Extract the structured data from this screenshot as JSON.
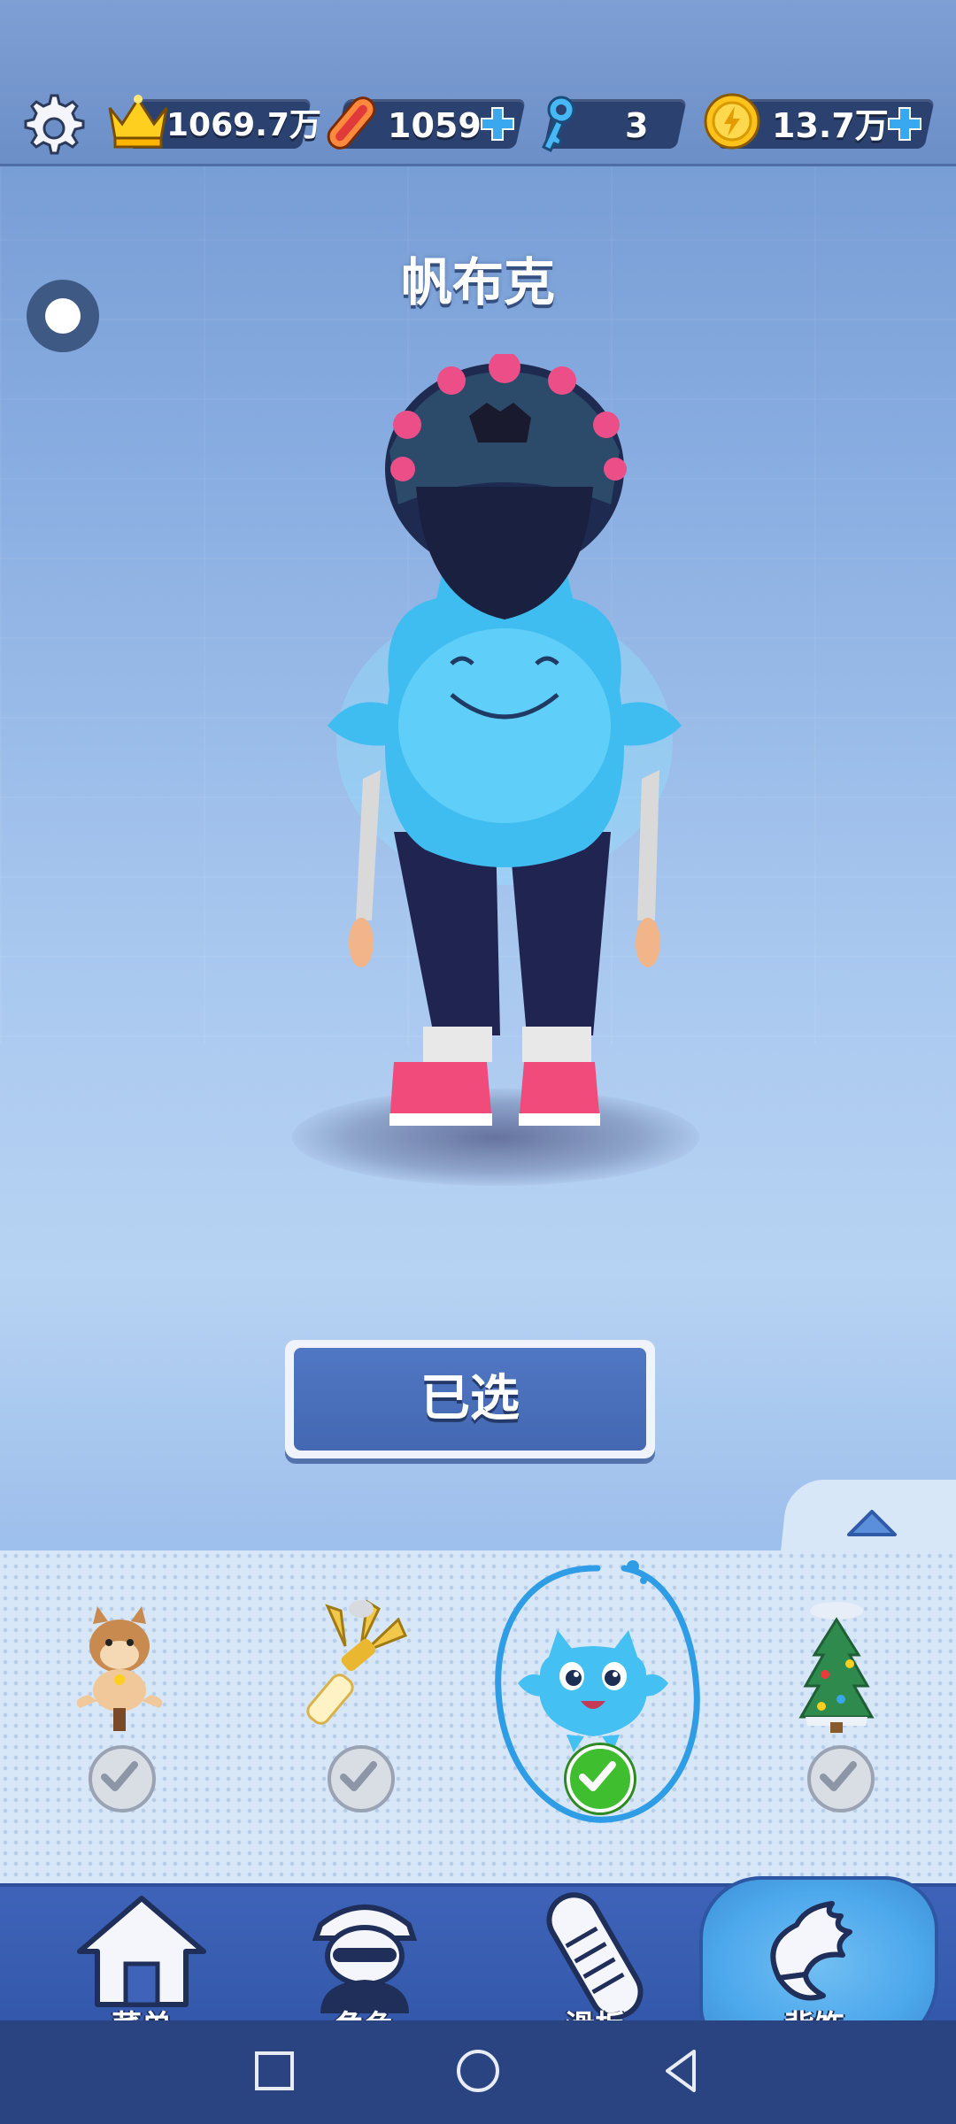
{
  "top_bar": {
    "crowns_value": "1069.7万",
    "boards_value": "1059",
    "keys_value": "3",
    "coins_value": "13.7万",
    "icons": [
      "gear-icon",
      "crown-icon",
      "hoverboard-icon",
      "key-icon",
      "coin-icon",
      "plus-icon"
    ]
  },
  "item": {
    "name": "帆布克",
    "button_label": "已选"
  },
  "tray": {
    "items": [
      {
        "icon": "hamster-backpack-icon",
        "state": "owned"
      },
      {
        "icon": "trophy-wings-backpack-icon",
        "state": "owned"
      },
      {
        "icon": "blue-slime-backpack-icon",
        "state": "selected"
      },
      {
        "icon": "christmas-tree-backpack-icon",
        "state": "owned"
      }
    ]
  },
  "nav": {
    "items": [
      {
        "label": "菜单",
        "icon": "home-icon"
      },
      {
        "label": "角色",
        "icon": "character-icon"
      },
      {
        "label": "滑板",
        "icon": "hoverboard-icon"
      },
      {
        "label": "背饰",
        "icon": "wings-icon"
      }
    ],
    "active": "背饰"
  },
  "colors": {
    "accent": "#4468b2",
    "selected_check": "#3fbf2f",
    "nav_active": "#4da8ec"
  }
}
